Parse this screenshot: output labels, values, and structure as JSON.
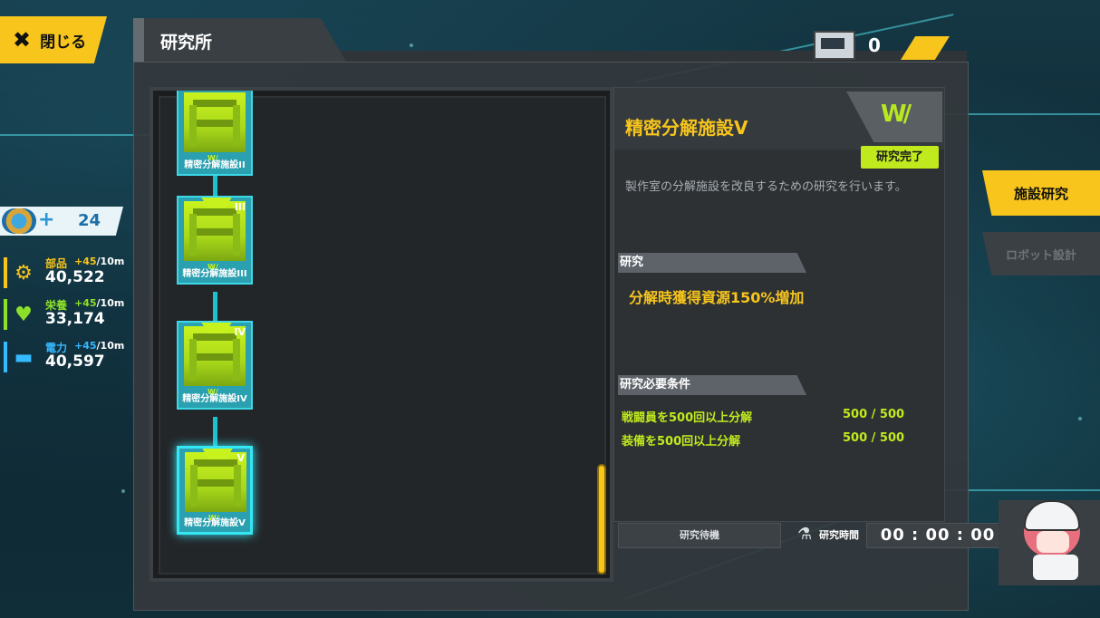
{
  "close_button": {
    "label": "閉じる",
    "icon": "close-icon"
  },
  "header": {
    "title": "研究所"
  },
  "currency": {
    "icon": "ticket-icon",
    "value": "0"
  },
  "resources": {
    "robots": {
      "icon": "robot-badge-icon",
      "value": "24"
    },
    "items": [
      {
        "name": "部品",
        "rate": "+45",
        "unit": "/10m",
        "amount": "40,522",
        "color": "#f7c51c",
        "icon": "gear-icon"
      },
      {
        "name": "栄養",
        "rate": "+45",
        "unit": "/10m",
        "amount": "33,174",
        "color": "#8de02a",
        "icon": "nutrition-icon"
      },
      {
        "name": "電力",
        "rate": "+45",
        "unit": "/10m",
        "amount": "40,597",
        "color": "#35b9ff",
        "icon": "battery-icon"
      }
    ]
  },
  "tree": {
    "nodes": [
      {
        "label": "精密分解施設II",
        "level": ""
      },
      {
        "label": "精密分解施設III",
        "level": "III"
      },
      {
        "label": "精密分解施設IV",
        "level": "IV"
      },
      {
        "label": "精密分解施設V",
        "level": "V"
      }
    ],
    "node_mark": "W/"
  },
  "detail": {
    "logo_text": "W/",
    "title": "精密分解施設V",
    "status_badge": "研究完了",
    "description": "製作室の分解施設を改良するための研究を行います。",
    "effect_header": "研究",
    "effect": "分解時獲得資源150%増加",
    "requirements_header": "研究必要条件",
    "requirements": [
      {
        "text": "戦闘員を500回以上分解",
        "progress": "500 / 500"
      },
      {
        "text": "装備を500回以上分解",
        "progress": "500 / 500"
      }
    ]
  },
  "footer": {
    "wait_label": "研究待機",
    "time_label": "研究時間",
    "time_value": "00 : 00 : 00"
  },
  "tabs": {
    "facility_research": "施設研究",
    "robot_design": "ロボット設計"
  }
}
